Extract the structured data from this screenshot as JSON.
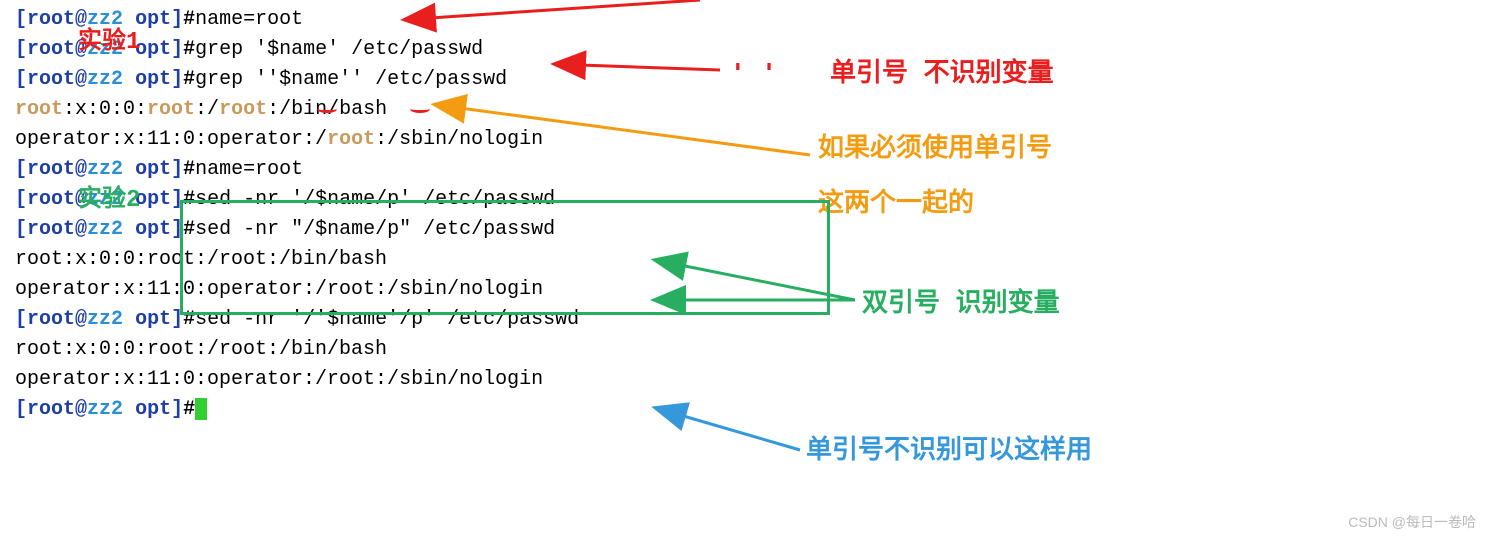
{
  "prompt": {
    "bracket_open": "[",
    "user": "root",
    "at": "@",
    "host": "zz2",
    "dir": "opt",
    "bracket_close": "]",
    "hash": "#"
  },
  "lines": {
    "l1_cmd": "name=root",
    "l2_cmd": "grep '$name' /etc/passwd",
    "l3_cmd": "grep ''$name'' /etc/passwd",
    "l4_pre": ":x:0:0:",
    "l4_mid1": ":/",
    "l4_mid2": ":/bin/bash",
    "l5_pre": "operator:x:11:0:operator:/",
    "l5_post": ":/sbin/nologin",
    "l6_cmd": "name=root",
    "l7_cmd": "sed -nr '/$name/p' /etc/passwd",
    "l8_cmd": "sed -nr \"/$name/p\" /etc/passwd",
    "l9": "root:x:0:0:root:/root:/bin/bash",
    "l10": "operator:x:11:0:operator:/root:/sbin/nologin",
    "l11_cmd": "sed -nr '/'$name'/p' /etc/passwd",
    "l12": "root:x:0:0:root:/root:/bin/bash",
    "l13": "operator:x:11:0:operator:/root:/sbin/nologin",
    "root_word": "root"
  },
  "annotations": {
    "label1": "实验1",
    "label2": "实验2",
    "red_quotes": "' '",
    "red_note": "单引号 不识别变量",
    "orange_note1": "如果必须使用单引号",
    "orange_note2": "这两个一起的",
    "green_note": "双引号  识别变量",
    "blue_note": "单引号不识别可以这样用",
    "watermark": "CSDN @每日一卷哈"
  }
}
